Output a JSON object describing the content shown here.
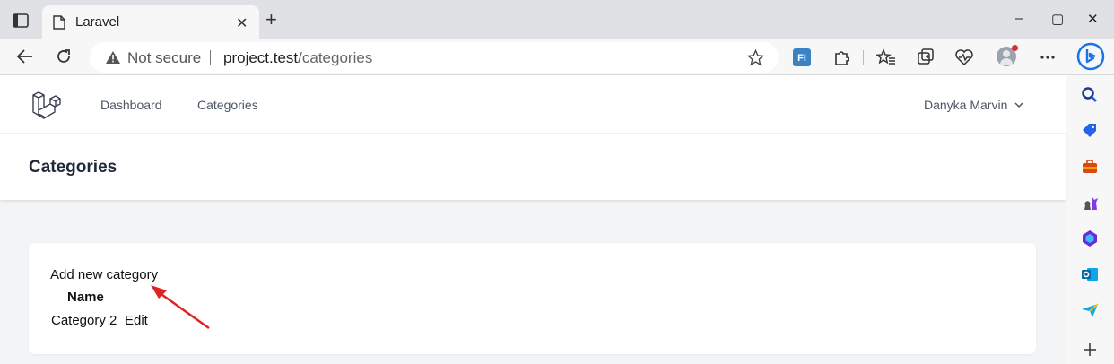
{
  "browser": {
    "tab_title": "Laravel",
    "tab_close": "✕",
    "new_tab": "+",
    "not_secure": "Not secure",
    "url_host": "project.test",
    "url_path": "/categories",
    "window_controls": [
      "–",
      "▢",
      "✕"
    ],
    "extension_badge": "FI"
  },
  "nav": {
    "links": [
      "Dashboard",
      "Categories"
    ],
    "user_name": "Danyka Marvin",
    "user_chevron": "⌄"
  },
  "header": {
    "title": "Categories"
  },
  "content": {
    "add_link": "Add new category",
    "columns": [
      "Name"
    ],
    "rows": [
      {
        "name": "Category 2",
        "action": "Edit"
      }
    ]
  },
  "colors": {
    "annotation_arrow": "#e02424",
    "bing_blue": "#1a73e8"
  }
}
